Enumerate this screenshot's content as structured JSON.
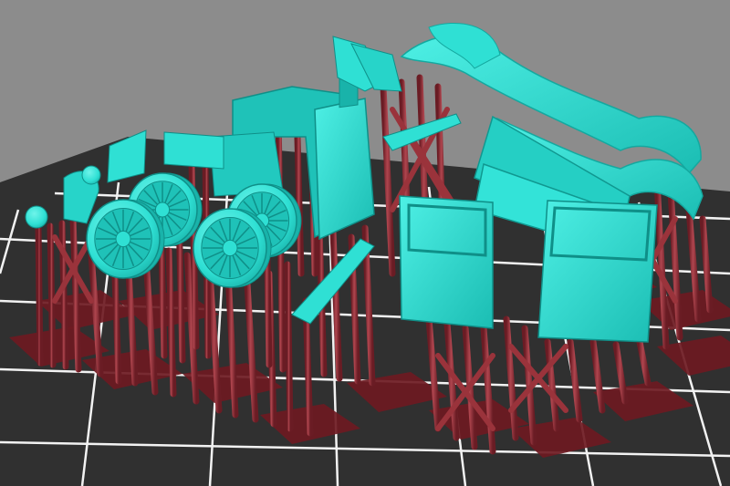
{
  "viewport": {
    "background_color": "#8c8c8c",
    "build_plate_color": "#303030",
    "grid_line_color": "#f2f2f2"
  },
  "colors": {
    "model": "#2fe0d4",
    "model_shade": "#19b3aa",
    "model_dark": "#0f8f88",
    "support": "#8a2b33",
    "support_light": "#b0464f",
    "support_base": "#6e1a22"
  },
  "objects": [
    {
      "name": "wheel-front-left",
      "kind": "spoked-wheel"
    },
    {
      "name": "wheel-rear-left",
      "kind": "spoked-wheel"
    },
    {
      "name": "wheel-front-right",
      "kind": "spoked-wheel"
    },
    {
      "name": "wheel-rear-right",
      "kind": "spoked-wheel"
    },
    {
      "name": "car-body-cab",
      "kind": "cab"
    },
    {
      "name": "door-left",
      "kind": "door"
    },
    {
      "name": "door-right",
      "kind": "door"
    },
    {
      "name": "fender-front",
      "kind": "fender"
    },
    {
      "name": "fender-rear",
      "kind": "fender"
    },
    {
      "name": "radiator-headlamps",
      "kind": "small-parts"
    },
    {
      "name": "running-board",
      "kind": "frame"
    }
  ]
}
